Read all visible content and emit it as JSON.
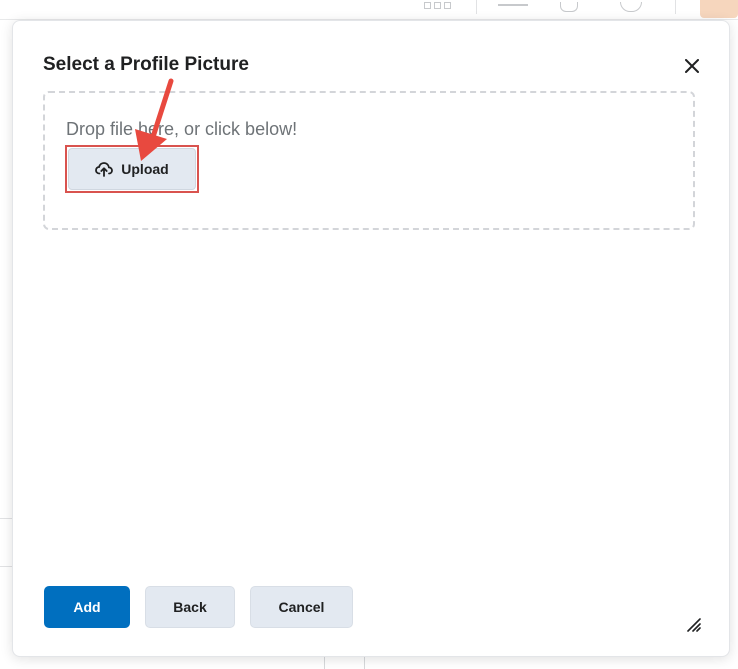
{
  "dialog": {
    "title": "Select a Profile Picture",
    "close_icon": "close-icon",
    "dropzone": {
      "instruction": "Drop file here, or click below!",
      "upload_label": "Upload",
      "upload_icon": "cloud-upload-icon"
    },
    "footer": {
      "add_label": "Add",
      "back_label": "Back",
      "cancel_label": "Cancel"
    },
    "resize_icon": "resize-handle-icon"
  },
  "annotation": {
    "highlight_color": "#d9534f",
    "arrow_color": "#e8493f"
  },
  "colors": {
    "primary": "#006fbf",
    "secondary_button": "#e3e9f1",
    "title_text": "#202122",
    "muted_text": "#6e7377"
  }
}
